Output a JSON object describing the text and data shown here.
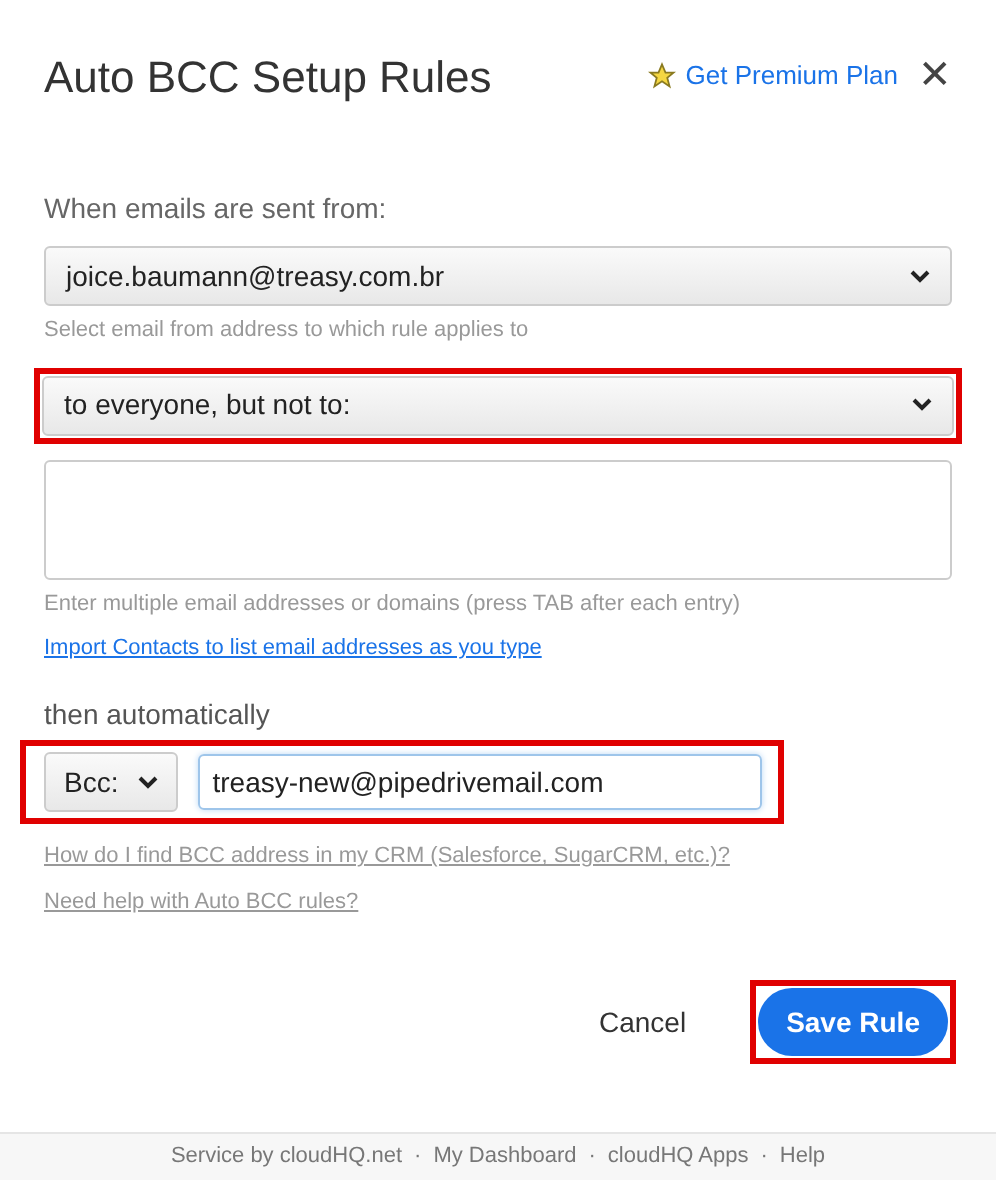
{
  "dialog": {
    "title": "Auto BCC Setup Rules",
    "premium_link": "Get Premium Plan",
    "close": "✕"
  },
  "from_label": "When emails are sent from:",
  "from_select": {
    "value": "joice.baumann@treasy.com.br",
    "highlighted": false
  },
  "from_hint": "Select email from address to which rule applies to",
  "recipients_select": {
    "value": "to everyone, but not to:",
    "highlighted": true
  },
  "recipients_hint": "Enter multiple email addresses or domains (press TAB after each entry)",
  "import_link": "Import Contacts to list email addresses as you type",
  "action_label": "then automatically",
  "action": {
    "mode": "Bcc:",
    "address": "treasy-new@pipedrivemail.com",
    "highlighted": true
  },
  "help_links": [
    "How do I find BCC address in my CRM (Salesforce, SugarCRM, etc.)?",
    "Need help with Auto BCC rules?"
  ],
  "buttons": [
    {
      "label": "Cancel",
      "kind": "plain",
      "highlighted": false
    },
    {
      "label": "Save Rule",
      "kind": "primary",
      "highlighted": true
    }
  ],
  "footer": {
    "separator": "·",
    "items": [
      "Service by cloudHQ.net",
      "My Dashboard",
      "cloudHQ Apps",
      "Help"
    ]
  }
}
